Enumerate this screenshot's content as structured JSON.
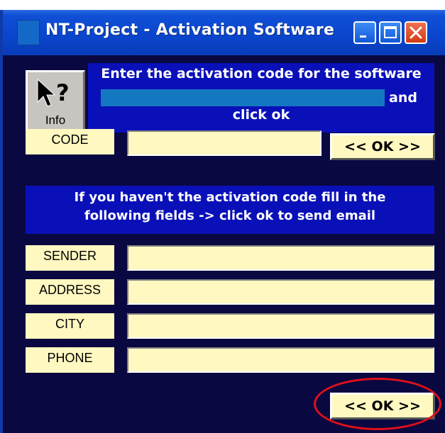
{
  "window": {
    "title": "NT-Project - Activation Software",
    "title_icon": "app-icon",
    "controls": [
      "minimize-icon",
      "maximize-icon",
      "close-icon"
    ]
  },
  "info_button": {
    "label": "Info",
    "icon": "help-arrow-icon"
  },
  "activation": {
    "instruction_line1": "Enter the activation code for the software",
    "instruction_and": "and",
    "instruction_line3": "click ok",
    "code_label": "CODE",
    "code_value": "",
    "ok_label": "<< OK >>"
  },
  "request": {
    "notice_line1": "If you haven't the activation code fill in the",
    "notice_line2": "following fields -> click ok to send email",
    "fields": [
      {
        "label": "SENDER",
        "value": ""
      },
      {
        "label": "ADDRESS",
        "value": ""
      },
      {
        "label": "CITY",
        "value": ""
      },
      {
        "label": "PHONE",
        "value": ""
      }
    ],
    "ok_label": "<< OK >>"
  },
  "colors": {
    "background": "#0a0840",
    "panel_blue": "#0a10b8",
    "field_yellow": "#fff8c0",
    "titlebar_blue": "#0a45cc",
    "highlight_red": "#e0101a"
  }
}
